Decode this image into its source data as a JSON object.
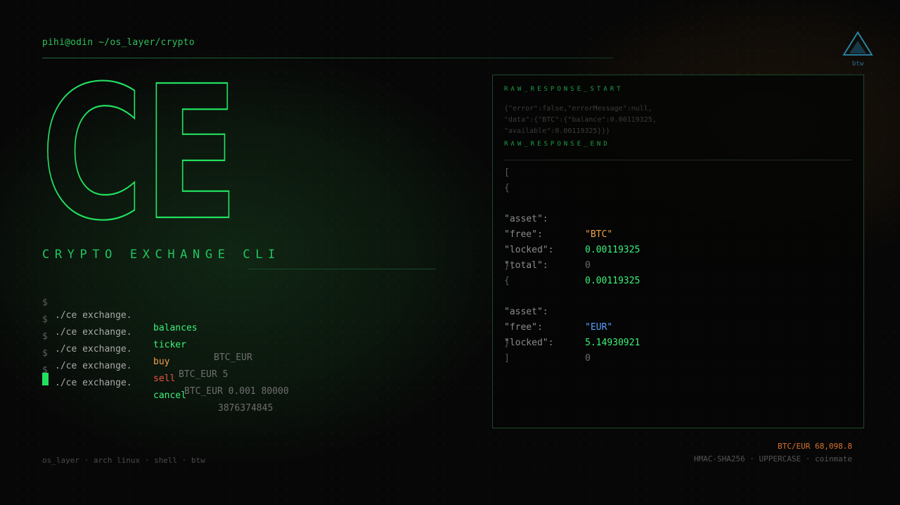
{
  "header": {
    "prompt_path": "pihi@odin ~/os_layer/crypto",
    "logo_label": "btw"
  },
  "hero": {
    "big_title": "CE",
    "subtitle": "CRYPTO EXCHANGE CLI"
  },
  "commands": [
    {
      "dollar": "$",
      "base": "./ce exchange.",
      "verb": "balances",
      "verb_color": "#3ef07a",
      "args": ""
    },
    {
      "dollar": "$",
      "base": "./ce exchange.",
      "verb": "ticker",
      "verb_color": "#3ef07a",
      "args": "BTC_EUR"
    },
    {
      "dollar": "$",
      "base": "./ce exchange.",
      "verb": "buy",
      "verb_color": "#f0a04b",
      "args": "BTC_EUR 5"
    },
    {
      "dollar": "$",
      "base": "./ce exchange.",
      "verb": "sell",
      "verb_color": "#f05545",
      "args": "BTC_EUR 0.001 80000"
    },
    {
      "dollar": "$",
      "base": "./ce exchange.",
      "verb": "cancel",
      "verb_color": "#3ef07a",
      "args": "3876374845"
    }
  ],
  "panel": {
    "raw_start": "RAW_RESPONSE_START",
    "raw_lines": [
      "{\"error\":false,\"errorMessage\":null,",
      "\"data\":{\"BTC\":{\"balance\":0.00119325,",
      "\"available\":0.00119325}}}"
    ],
    "raw_end": "RAW_RESPONSE_END",
    "open_bracket": "[",
    "close_bracket": "]",
    "open_brace_1": "{",
    "close_brace_1": "},",
    "open_brace_2": "{",
    "close_brace_2": "}",
    "asset_btc": [
      {
        "key": "\"asset\":",
        "value": "\"BTC\"",
        "color": "#f0a04b"
      },
      {
        "key": "\"free\":",
        "value": "0.00119325",
        "color": "#3ef07a"
      },
      {
        "key": "\"locked\":",
        "value": "0",
        "color": "#6a6a6a"
      },
      {
        "key": "\"total\":",
        "value": "0.00119325",
        "color": "#3ef07a"
      }
    ],
    "asset_eur": [
      {
        "key": "\"asset\":",
        "value": "\"EUR\"",
        "color": "#5aa0ff"
      },
      {
        "key": "\"free\":",
        "value": "5.14930921",
        "color": "#3ef07a"
      },
      {
        "key": "\"locked\":",
        "value": "0",
        "color": "#6a6a6a"
      }
    ]
  },
  "footer": {
    "left": "os_layer · arch linux · shell · btw",
    "price": "BTC/EUR 68,098.8",
    "right": "HMAC-SHA256 · UPPERCASE · coinmate"
  },
  "colors": {
    "accent_green": "#22c55e",
    "bright_green": "#3ef07a",
    "orange": "#f0a04b",
    "red": "#f05545",
    "blue": "#5aa0ff",
    "background": "#070707"
  }
}
